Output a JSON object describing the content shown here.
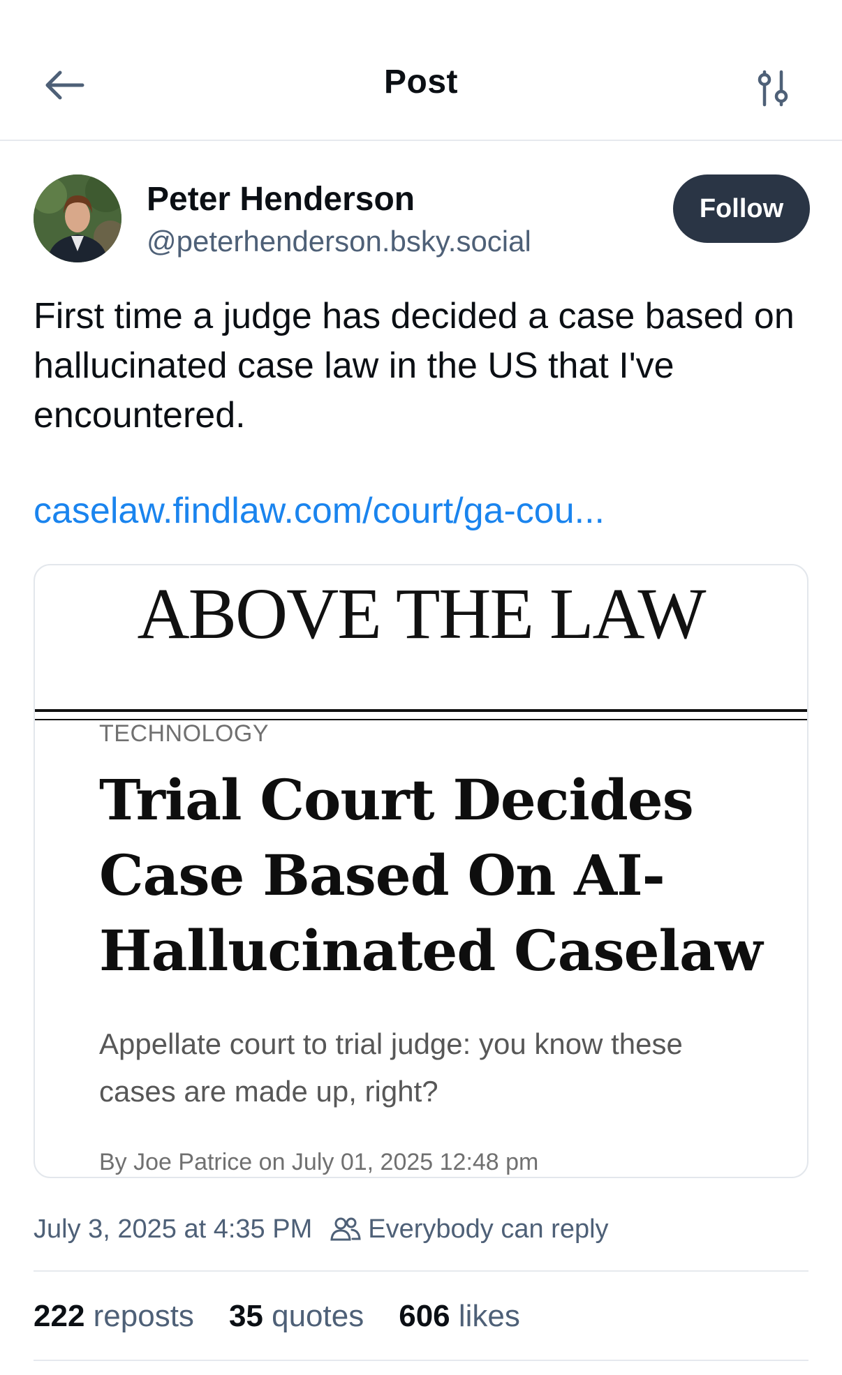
{
  "header": {
    "title": "Post",
    "back_icon": "arrow-left-icon",
    "filter_icon": "sliders-icon"
  },
  "author": {
    "name": "Peter Henderson",
    "handle": "@peterhenderson.bsky.social",
    "follow_label": "Follow"
  },
  "post": {
    "text": "First time a judge has decided a case based on hallucinated case law in the US that I've encountered.",
    "link": "caselaw.findlaw.com/court/ga-cou..."
  },
  "card": {
    "logo": "ABOVE THE LAW",
    "category": "TECHNOLOGY",
    "headline": "Trial Court Decides Case Based On AI-Hallucinated Caselaw",
    "subtitle": "Appellate court to trial judge: you know these cases are made up, right?",
    "byline": "By Joe Patrice on July 01, 2025 12:48 pm"
  },
  "meta": {
    "timestamp": "July 3, 2025 at 4:35 PM",
    "reply_setting": "Everybody can reply"
  },
  "stats": {
    "reposts_count": "222",
    "reposts_label": "reposts",
    "quotes_count": "35",
    "quotes_label": "quotes",
    "likes_count": "606",
    "likes_label": "likes"
  },
  "colors": {
    "link": "#1a84ee",
    "follow_bg": "#2a3545",
    "muted": "#4e6077"
  }
}
